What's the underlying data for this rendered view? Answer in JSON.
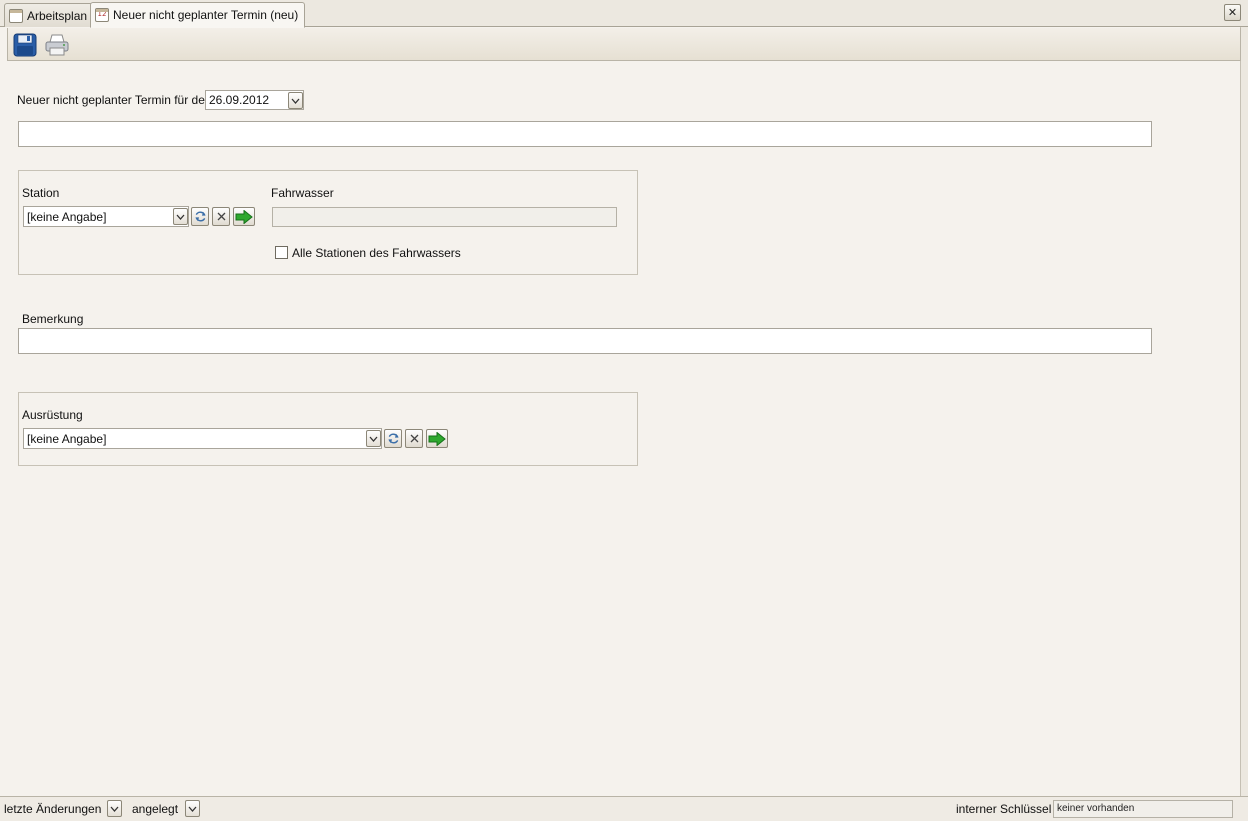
{
  "tabs": [
    {
      "label": "Arbeitsplan",
      "icon": "calendar-icon",
      "active": false
    },
    {
      "label": "Neuer nicht geplanter Termin (neu)",
      "icon": "calendar-12-icon",
      "icon_text": "12",
      "active": true
    }
  ],
  "toolbar": {
    "save_icon": "save-disk-icon",
    "print_icon": "printer-icon"
  },
  "form": {
    "date_label": "Neuer nicht geplanter Termin für den",
    "date_value": "26.09.2012",
    "title_value": "",
    "station": {
      "label": "Station",
      "value": "[keine Angabe]",
      "buttons": [
        "dropdown-icon",
        "refresh-icon",
        "clear-icon",
        "goto-arrow-icon"
      ]
    },
    "fahrwasser": {
      "label": "Fahrwasser",
      "value": ""
    },
    "all_stations_checkbox": {
      "label": "Alle Stationen des Fahrwassers",
      "checked": false
    },
    "bemerkung": {
      "label": "Bemerkung",
      "value": ""
    },
    "ausruestung": {
      "label": "Ausrüstung",
      "value": "[keine Angabe]"
    }
  },
  "statusbar": {
    "last_changes_label": "letzte Änderungen",
    "created_label": "angelegt",
    "internal_key_label": "interner Schlüssel",
    "internal_key_value": "keiner vorhanden"
  },
  "colors": {
    "background": "#f5f2ed",
    "arrow_green": "#2ea82e",
    "save_blue": "#2a5ea8"
  }
}
